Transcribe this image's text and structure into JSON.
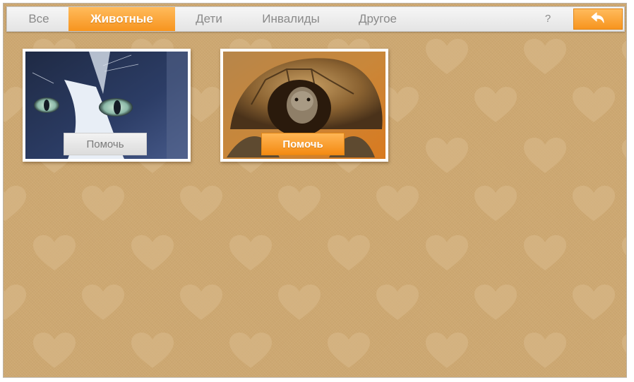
{
  "tabs": [
    {
      "label": "Все"
    },
    {
      "label": "Животные"
    },
    {
      "label": "Дети"
    },
    {
      "label": "Инвалиды"
    },
    {
      "label": "Другое"
    }
  ],
  "active_tab": "Животные",
  "help_label": "?",
  "back_icon": "back-arrow-icon",
  "cards": [
    {
      "animal": "cat",
      "button_label": "Помочь",
      "button_state": "default"
    },
    {
      "animal": "turtle",
      "button_label": "Помочь",
      "button_state": "highlighted"
    }
  ],
  "colors": {
    "accent": "#f7941e",
    "background": "#cda872",
    "heart": "#d6b685",
    "tab_text": "#8a8a8a"
  }
}
